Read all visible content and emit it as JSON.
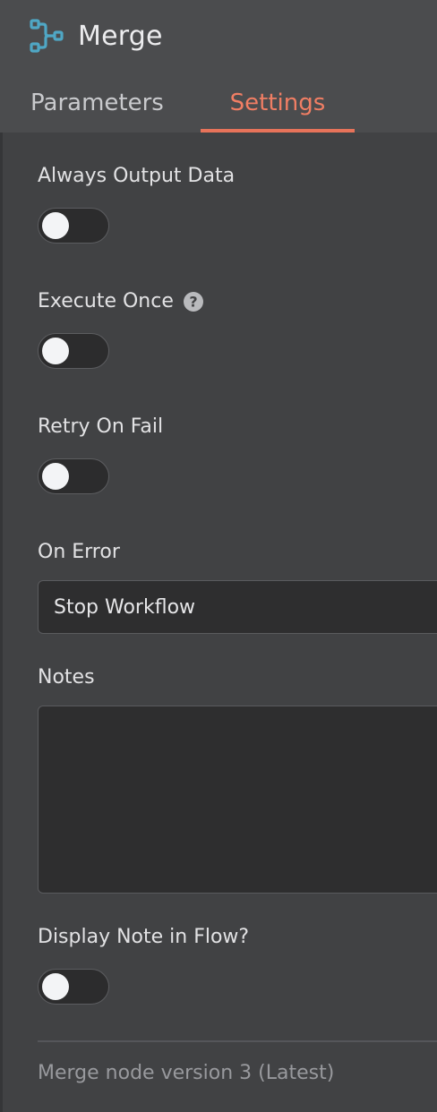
{
  "header": {
    "title": "Merge",
    "icon": "merge-icon",
    "icon_color": "#4fa7c5"
  },
  "tabs": [
    {
      "label": "Parameters",
      "active": false
    },
    {
      "label": "Settings",
      "active": true
    }
  ],
  "accent_color": "#e7735a",
  "settings": {
    "always_output_data": {
      "label": "Always Output Data",
      "enabled": false
    },
    "execute_once": {
      "label": "Execute Once",
      "enabled": false,
      "help_icon": "question-circle-icon"
    },
    "retry_on_fail": {
      "label": "Retry On Fail",
      "enabled": false
    },
    "on_error": {
      "label": "On Error",
      "value": "Stop Workflow"
    },
    "notes": {
      "label": "Notes",
      "value": ""
    },
    "display_note": {
      "label": "Display Note in Flow?",
      "enabled": false
    }
  },
  "footer": {
    "version_text": "Merge node version 3 (Latest)"
  }
}
